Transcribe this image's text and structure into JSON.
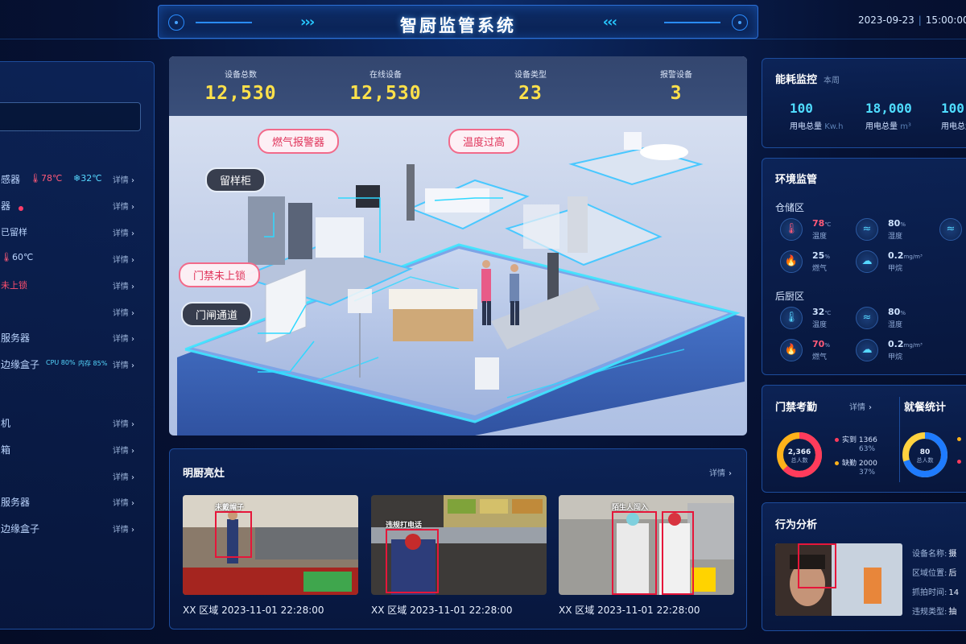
{
  "header": {
    "title": "智厨监管系统",
    "date": "2023-09-23",
    "time": "15:00:00"
  },
  "left_panel": {
    "rows": [
      {
        "name": "感器",
        "extra1": "78℃",
        "extra2": "32℃",
        "detail": "详情"
      },
      {
        "name": "器",
        "detail": "详情"
      },
      {
        "name": "已留样",
        "detail": "详情"
      },
      {
        "name": "60℃",
        "detail": "详情"
      },
      {
        "name": "未上锁",
        "detail": "详情"
      },
      {
        "name": "",
        "detail": "详情"
      },
      {
        "name": "服务器",
        "detail": "详情"
      },
      {
        "name": "边缘盒子",
        "cpu": "CPU 80%",
        "mem": "内存 85%",
        "detail": "详情"
      },
      {
        "name": "机",
        "detail": "详情"
      },
      {
        "name": "箱",
        "detail": "详情"
      },
      {
        "name": "",
        "detail": "详情"
      },
      {
        "name": "服务器",
        "detail": "详情"
      },
      {
        "name": "边缘盒子",
        "detail": "详情"
      }
    ]
  },
  "stats": [
    {
      "label": "设备总数",
      "value": "12,530"
    },
    {
      "label": "在线设备",
      "value": "12,530"
    },
    {
      "label": "设备类型",
      "value": "23"
    },
    {
      "label": "报警设备",
      "value": "3"
    }
  ],
  "scene_tags": {
    "gas_alarm": "燃气报警器",
    "temp_high": "温度过高",
    "sample_cabinet": "留样柜",
    "door_unlocked": "门禁未上锁",
    "gate_channel": "门闸通道"
  },
  "kitchen": {
    "title": "明厨亮灶",
    "detail": "详情",
    "cams": [
      {
        "warning": "未戴帽子",
        "caption": "XX 区域  2023-11-01 22:28:00"
      },
      {
        "warning": "违规打电话",
        "caption": "XX 区域  2023-11-01 22:28:00"
      },
      {
        "warning": "陌生人闯入",
        "caption": "XX 区域  2023-11-01 22:28:00"
      }
    ]
  },
  "energy": {
    "title": "能耗监控",
    "period": "本周",
    "items": [
      {
        "value": "100",
        "label": "用电总量",
        "unit": "Kw.h"
      },
      {
        "value": "18,000",
        "label": "用电总量",
        "unit": "m³"
      },
      {
        "value": "100",
        "label": "用电总量",
        "unit": ""
      }
    ]
  },
  "environment": {
    "title": "环境监管",
    "zones": [
      {
        "name": "仓储区",
        "temp": "78",
        "temp_unit": "℃",
        "temp_label": "温度",
        "humid": "80",
        "humid_unit": "%",
        "humid_label": "湿度",
        "gas": "25",
        "gas_unit": "%",
        "gas_label": "燃气",
        "methanal": "0.2",
        "methanal_unit": "mg/m³",
        "methanal_label": "甲烷"
      },
      {
        "name": "后厨区",
        "temp": "32",
        "temp_unit": "℃",
        "temp_label": "温度",
        "humid": "80",
        "humid_unit": "%",
        "humid_label": "湿度",
        "gas": "70",
        "gas_unit": "%",
        "gas_label": "燃气",
        "methanal": "0.2",
        "methanal_unit": "mg/m³",
        "methanal_label": "甲烷"
      }
    ]
  },
  "access": {
    "title": "门禁考勤",
    "detail": "详情",
    "total": "2,366",
    "total_label": "总人数",
    "present_label": "实到",
    "present_value": "1366",
    "present_pct": "63%",
    "absent_label": "缺勤",
    "absent_value": "2000",
    "absent_pct": "37%",
    "present_fraction": 0.63,
    "colors": {
      "present": "#ff3b5c",
      "absent": "#ffb21a"
    }
  },
  "dining": {
    "title": "就餐统计",
    "total": "80",
    "total_label": "总人数",
    "fraction": 0.7,
    "colors": {
      "primary": "#1e7bff",
      "secondary": "#ffd23f"
    }
  },
  "behavior": {
    "title": "行为分析",
    "fields": [
      {
        "label": "设备名称:",
        "value": "摄"
      },
      {
        "label": "区域位置:",
        "value": "后"
      },
      {
        "label": "抓拍时间:",
        "value": "14"
      },
      {
        "label": "违规类型:",
        "value": "抽"
      }
    ]
  }
}
